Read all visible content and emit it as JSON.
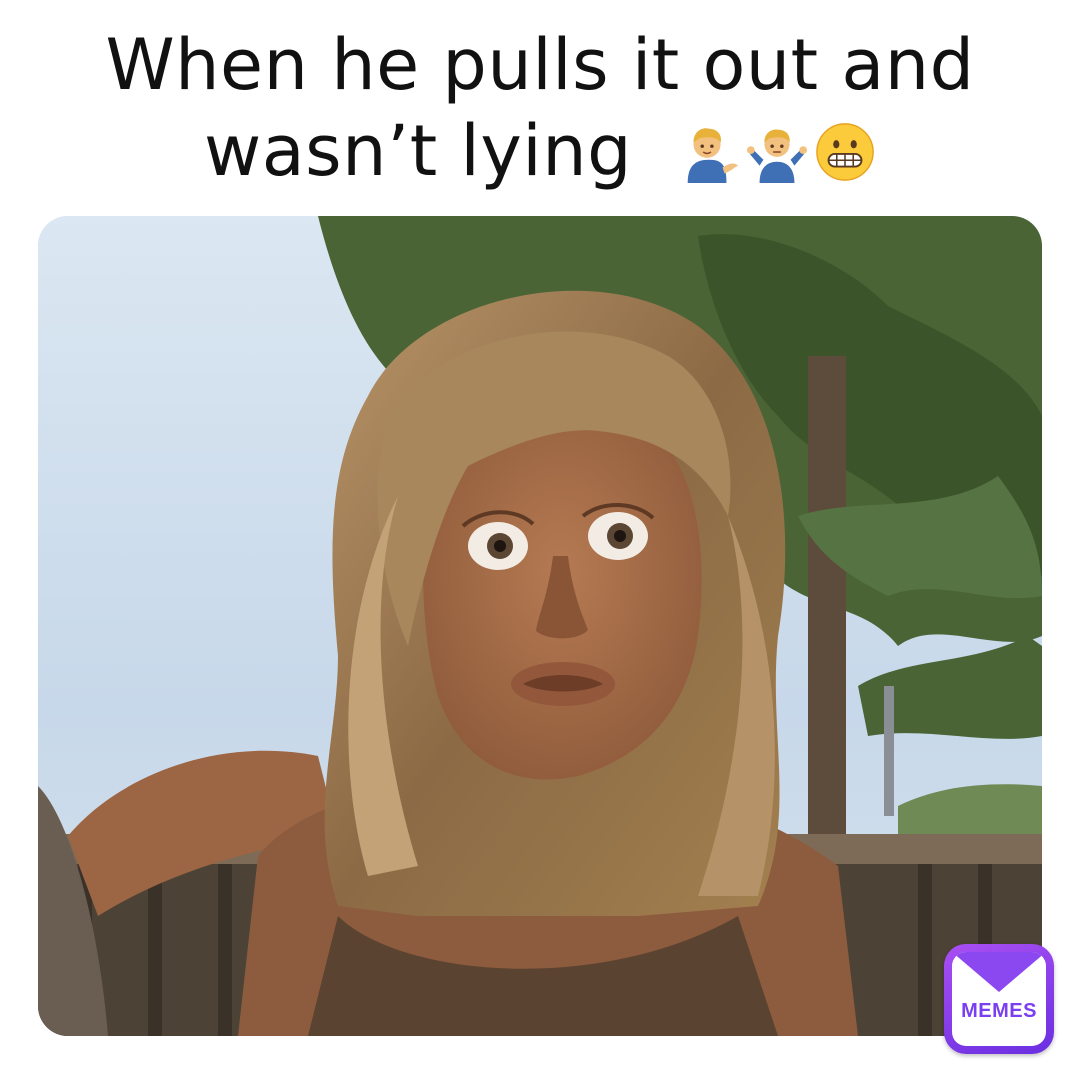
{
  "caption": {
    "line1": "When he pulls it out and",
    "line2": "wasn’t lying",
    "emojis": [
      "man-tipping-hand-icon",
      "man-shrugging-icon",
      "grimacing-face-icon"
    ]
  },
  "watermark": {
    "label": "MEMES",
    "colors": {
      "gradient_start": "#a94ff3",
      "gradient_end": "#6a2fe0"
    }
  },
  "photo": {
    "subject": "woman with wide eyes and pursed lips",
    "colors": {
      "sky": "#cfe0ef",
      "foliage": "#3f5a2e",
      "hair": "#9b7650",
      "skin": "#a8714e"
    }
  }
}
